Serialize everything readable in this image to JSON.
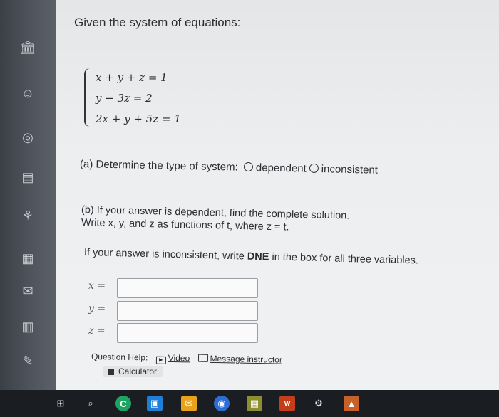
{
  "question": {
    "title": "Given the system of equations:",
    "equations": [
      "x + y + z = 1",
      "y − 3z = 2",
      "2x + y + 5z = 1"
    ],
    "part_a": {
      "prompt": "(a) Determine the type of system:",
      "options": [
        "dependent",
        "inconsistent"
      ]
    },
    "part_b": {
      "line1": "(b) If your answer is dependent, find the complete solution.",
      "line2": "Write x, y, and z as functions of t, where z = t.",
      "inconsistent_note_pre": "If your answer is inconsistent, write ",
      "inconsistent_note_bold": "DNE",
      "inconsistent_note_post": " in the box for all three variables."
    },
    "variables": [
      {
        "label": "x =",
        "value": ""
      },
      {
        "label": "y =",
        "value": ""
      },
      {
        "label": "z =",
        "value": ""
      }
    ],
    "help": {
      "label": "Question Help:",
      "video": "Video",
      "message": "Message instructor",
      "calculator": "Calculator"
    }
  },
  "rail_icons": [
    "bank-icon",
    "user-icon",
    "globe-icon",
    "book-icon",
    "group-icon",
    "calendar-icon",
    "mail-icon",
    "document-icon",
    "edit-icon"
  ],
  "taskbar_icons": [
    "windows-icon",
    "search-icon",
    "chrome-icon",
    "file-explorer-icon",
    "mail-icon",
    "browser-icon",
    "calculator-icon",
    "word-icon",
    "settings-icon",
    "photos-icon"
  ],
  "colors": {
    "page": "#eceef0",
    "text": "#2b2d31",
    "taskbar": "#1a1d22",
    "chrome": "#1da462",
    "word": "#c43e1c"
  }
}
